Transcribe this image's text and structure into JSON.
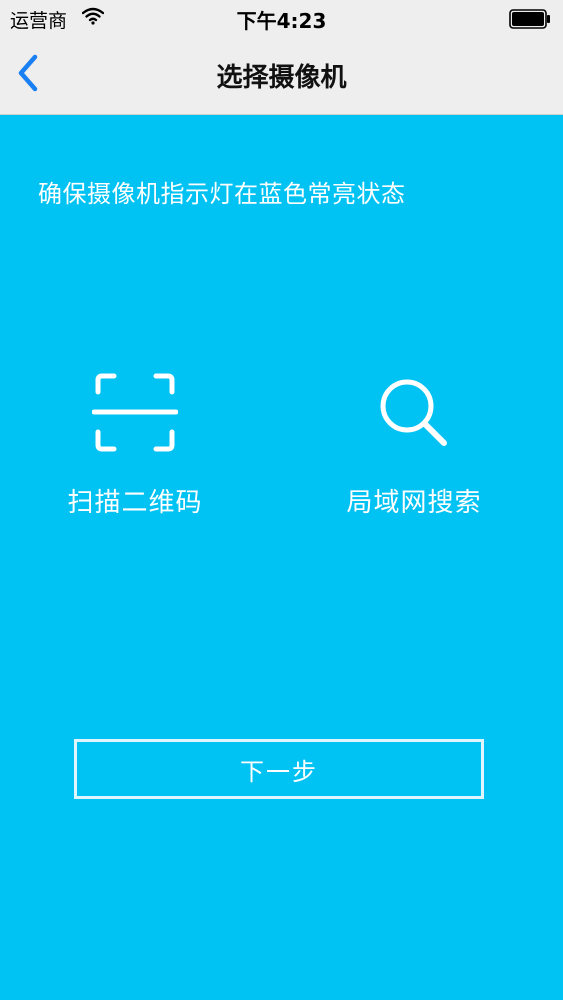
{
  "status_bar": {
    "carrier": "运营商",
    "time": "下午4:23"
  },
  "nav": {
    "title": "选择摄像机"
  },
  "instruction": "确保摄像机指示灯在蓝色常亮状态",
  "options": [
    {
      "label": "扫描二维码",
      "icon": "qr-scan-icon"
    },
    {
      "label": "局域网搜索",
      "icon": "search-icon"
    }
  ],
  "next_button": "下一步",
  "colors": {
    "background": "#00c2f3",
    "nav_background": "#eeeeef",
    "accent": "#1a7ff2"
  }
}
